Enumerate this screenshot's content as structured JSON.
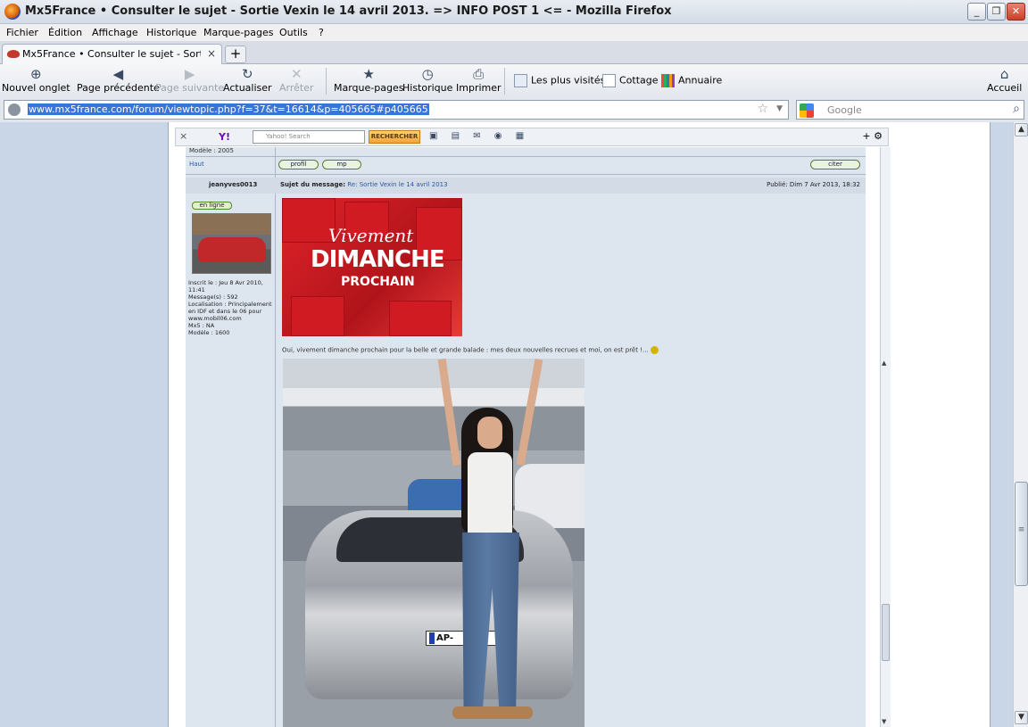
{
  "window": {
    "title": "Mx5France • Consulter le sujet - Sortie Vexin le 14 avril 2013. => INFO POST 1 <= - Mozilla Firefox",
    "minimize": "_",
    "maximize": "❐",
    "close": "✕"
  },
  "menu": [
    "Fichier",
    "Édition",
    "Affichage",
    "Historique",
    "Marque-pages",
    "Outils",
    "?"
  ],
  "tabs": [
    {
      "label": "Mx5France • Consulter le sujet - Sortie Vexi...",
      "close": "×"
    }
  ],
  "new_tab": "+",
  "toolbar": {
    "new_tab": "Nouvel onglet",
    "back": "Page précédente",
    "forward": "Page suivante",
    "reload": "Actualiser",
    "stop": "Arrêter",
    "bookmarks": "Marque-pages",
    "history": "Historique",
    "print": "Imprimer",
    "home": "Accueil"
  },
  "bookmarks_bar": [
    "Les plus visités",
    "Cottage",
    "Annuaire"
  ],
  "address": {
    "url": "www.mx5france.com/forum/viewtopic.php?f=37&t=16614&p=405665#p405665",
    "star": "☆",
    "dropdown": "▼"
  },
  "search": {
    "placeholder": "Google",
    "icon": "⌕"
  },
  "yahoo_toolbar": {
    "close": "×",
    "logo": "Y!",
    "search_placeholder": "Yahoo! Search",
    "search_button": "RECHERCHER",
    "right_icons": "+ ⚙"
  },
  "forum": {
    "prev_post_model": "Modèle : 2005",
    "top_link": "Haut",
    "buttons": {
      "profile": "profil",
      "pm": "mp",
      "quote": "citer"
    },
    "post": {
      "author": "jeanyves0013",
      "subject_label": "Sujet du message:",
      "subject_value": "Re: Sortie Vexin le 14 avril 2013",
      "posted": "Publié: Dim 7 Avr 2013, 18:32",
      "online_badge": "en ligne",
      "profile": {
        "registered": "Inscrit le : Jeu 8 Avr 2010, 11:41",
        "messages": "Message(s) : 592",
        "location": "Localisation : Principalement en IDF et dans le 06 pour www.mobil06.com",
        "mx5": "Mx5 : NA",
        "model": "Modèle : 1600"
      },
      "image1_text": {
        "line1": "Vivement",
        "line2": "DIMANCHE",
        "line3": "PROCHAIN"
      },
      "body": "Oui, vivement dimanche prochain pour la belle et grande balade : mes deux nouvelles recrues et moi, on est prêt !...",
      "plate": "AP-"
    }
  },
  "scroll": {
    "up": "▲",
    "down": "▼",
    "grip": "≡"
  }
}
